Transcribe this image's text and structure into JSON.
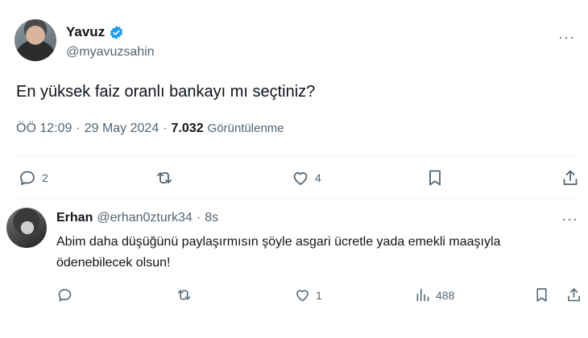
{
  "tweet": {
    "author": {
      "name": "Yavuz",
      "handle": "@myavuzsahin"
    },
    "more": "···",
    "text": "En yüksek faiz oranlı bankayı mı seçtiniz?",
    "meta": {
      "time": "ÖÖ 12:09",
      "sep1": "·",
      "date": "29 May 2024",
      "sep2": "·",
      "views": "7.032",
      "views_label": "Görüntülenme"
    },
    "stats": {
      "replies": "2",
      "reposts": "",
      "likes": "4"
    }
  },
  "reply": {
    "author": {
      "name": "Erhan",
      "handle": "@erhan0zturk34"
    },
    "dot": "·",
    "time": "8s",
    "more": "···",
    "text": "Abim daha düşüğünü paylaşırmısın şöyle asgari ücretle yada emekli maaşıyla ödenebilecek olsun!",
    "stats": {
      "replies": "",
      "reposts": "",
      "likes": "1",
      "views": "488"
    }
  },
  "colors": {
    "verified": "#1d9bf0",
    "secondary_text": "#536471",
    "divider": "#eff3f4"
  }
}
